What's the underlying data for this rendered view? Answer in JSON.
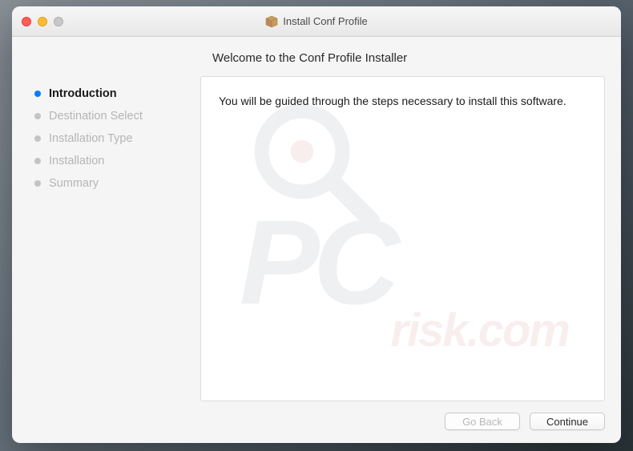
{
  "titlebar": {
    "title": "Install Conf Profile"
  },
  "heading": "Welcome to the Conf Profile Installer",
  "sidebar": {
    "steps": [
      {
        "label": "Introduction",
        "active": true
      },
      {
        "label": "Destination Select",
        "active": false
      },
      {
        "label": "Installation Type",
        "active": false
      },
      {
        "label": "Installation",
        "active": false
      },
      {
        "label": "Summary",
        "active": false
      }
    ]
  },
  "main": {
    "body_text": "You will be guided through the steps necessary to install this software."
  },
  "buttons": {
    "back": "Go Back",
    "continue": "Continue"
  },
  "watermark": {
    "top": "PC",
    "bottom": "risk.com"
  }
}
